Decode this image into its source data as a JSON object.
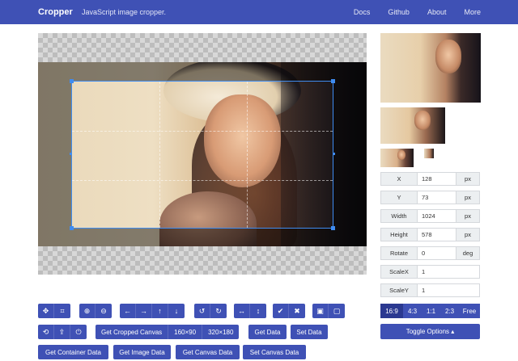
{
  "navbar": {
    "brand": "Cropper",
    "tagline": "JavaScript image cropper.",
    "links": [
      "Docs",
      "Github",
      "About",
      "More"
    ]
  },
  "toolbar": {
    "row1": [
      {
        "icon": "move-icon",
        "glyph": "✥"
      },
      {
        "icon": "crop-icon",
        "glyph": "⌗"
      },
      {
        "icon": "zoom-in-icon",
        "glyph": "⊕"
      },
      {
        "icon": "zoom-out-icon",
        "glyph": "⊖"
      },
      {
        "icon": "arrow-left-icon",
        "glyph": "←"
      },
      {
        "icon": "arrow-right-icon",
        "glyph": "→"
      },
      {
        "icon": "arrow-up-icon",
        "glyph": "↑"
      },
      {
        "icon": "arrow-down-icon",
        "glyph": "↓"
      },
      {
        "icon": "rotate-left-icon",
        "glyph": "↺"
      },
      {
        "icon": "rotate-right-icon",
        "glyph": "↻"
      },
      {
        "icon": "flip-horizontal-icon",
        "glyph": "↔"
      },
      {
        "icon": "flip-vertical-icon",
        "glyph": "↕"
      },
      {
        "icon": "check-icon",
        "glyph": "✔"
      },
      {
        "icon": "close-icon",
        "glyph": "✖"
      },
      {
        "icon": "lock-icon",
        "glyph": "▣"
      },
      {
        "icon": "unlock-icon",
        "glyph": "▢"
      }
    ],
    "row2_icons": [
      {
        "icon": "reset-icon",
        "glyph": "⟲"
      },
      {
        "icon": "upload-icon",
        "glyph": "⇪"
      },
      {
        "icon": "power-icon",
        "glyph": "⏻"
      }
    ],
    "get_cropped_canvas": "Get Cropped Canvas",
    "size_160": "160×90",
    "size_320": "320×180",
    "get_data": "Get Data",
    "set_data": "Set Data",
    "get_container_data": "Get Container Data",
    "get_image_data": "Get Image Data",
    "get_canvas_data": "Get Canvas Data",
    "set_canvas_data": "Set Canvas Data"
  },
  "fields": [
    {
      "label": "X",
      "value": "128",
      "unit": "px"
    },
    {
      "label": "Y",
      "value": "73",
      "unit": "px"
    },
    {
      "label": "Width",
      "value": "1024",
      "unit": "px"
    },
    {
      "label": "Height",
      "value": "578",
      "unit": "px"
    },
    {
      "label": "Rotate",
      "value": "0",
      "unit": "deg"
    },
    {
      "label": "ScaleX",
      "value": "1",
      "unit": ""
    },
    {
      "label": "ScaleY",
      "value": "1",
      "unit": ""
    }
  ],
  "aspect_ratios": [
    "16:9",
    "4:3",
    "1:1",
    "2:3",
    "Free"
  ],
  "active_ratio": "16:9",
  "toggle_options": "Toggle Options ▴",
  "colors": {
    "primary": "#3f51b5",
    "crop_border": "#3f8cf0"
  }
}
